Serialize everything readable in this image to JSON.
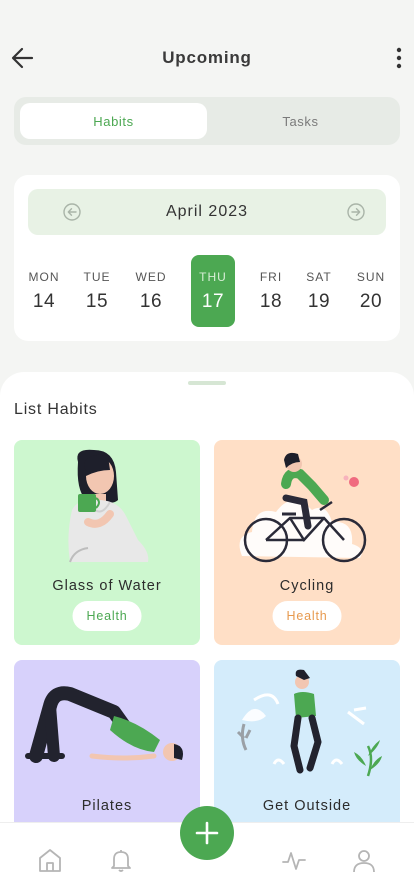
{
  "header": {
    "title": "Upcoming"
  },
  "segment": {
    "habits_label": "Habits",
    "tasks_label": "Tasks"
  },
  "calendar": {
    "month": "April 2023",
    "days": [
      {
        "name": "MON",
        "num": "14"
      },
      {
        "name": "TUE",
        "num": "15"
      },
      {
        "name": "WED",
        "num": "16"
      },
      {
        "name": "THU",
        "num": "17"
      },
      {
        "name": "FRI",
        "num": "18"
      },
      {
        "name": "SAT",
        "num": "19"
      },
      {
        "name": "SUN",
        "num": "20"
      }
    ],
    "selected_day": "THU 17"
  },
  "list": {
    "title": "List Habits",
    "habits": [
      {
        "name": "Glass of Water",
        "tag": "Health",
        "bg": "#cdf7cf",
        "tag_color": "#4ca852"
      },
      {
        "name": "Cycling",
        "tag": "Health",
        "bg": "#ffdfc6",
        "tag_color": "#e79a4f"
      },
      {
        "name": "Pilates",
        "tag": "",
        "bg": "#d7d1fb"
      },
      {
        "name": "Get Outside",
        "tag": "",
        "bg": "#d4ecfb"
      }
    ]
  },
  "colors": {
    "accent": "#4ca852",
    "accent_light": "#e8f2e5"
  },
  "nav": {
    "icons": [
      "home-icon",
      "bell-icon",
      "add-icon",
      "activity-icon",
      "profile-icon"
    ]
  }
}
